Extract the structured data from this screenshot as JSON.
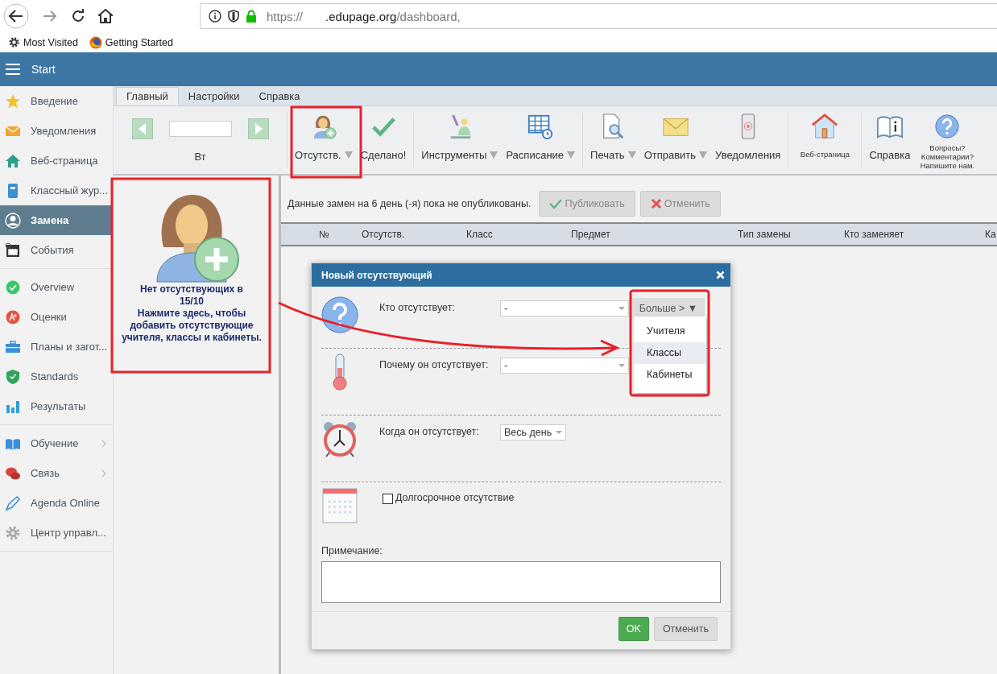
{
  "browser": {
    "url_scheme": "https://",
    "url_domain": ".edupage.org",
    "url_path": "/dashboard,",
    "bookmarks": [
      {
        "label": "Most Visited",
        "kind": "gear"
      },
      {
        "label": "Getting Started",
        "kind": "globe"
      }
    ]
  },
  "app_bar": {
    "title": "Start"
  },
  "sidebar": {
    "groups": [
      {
        "items": [
          {
            "label": "Введение",
            "kind": "star",
            "selected": false,
            "submenu": false
          },
          {
            "label": "Уведомления",
            "kind": "envelope",
            "selected": false,
            "submenu": false
          },
          {
            "label": "Веб-страница",
            "kind": "house",
            "selected": false,
            "submenu": false
          },
          {
            "label": "Классный жур...",
            "kind": "notebook",
            "selected": false,
            "submenu": false
          },
          {
            "label": "Замена",
            "kind": "user",
            "selected": true,
            "submenu": false
          },
          {
            "label": "События",
            "kind": "calendar",
            "selected": false,
            "submenu": false
          }
        ]
      },
      {
        "items": [
          {
            "label": "Overview",
            "kind": "check",
            "selected": false,
            "submenu": false
          },
          {
            "label": "Оценки",
            "kind": "grade",
            "selected": false,
            "submenu": false
          },
          {
            "label": "Планы и загот...",
            "kind": "briefcase",
            "selected": false,
            "submenu": false
          },
          {
            "label": "Standards",
            "kind": "shield",
            "selected": false,
            "submenu": false
          },
          {
            "label": "Результаты",
            "kind": "chart",
            "selected": false,
            "submenu": false
          }
        ]
      },
      {
        "items": [
          {
            "label": "Обучение",
            "kind": "book",
            "selected": false,
            "submenu": true
          },
          {
            "label": "Связь",
            "kind": "chat",
            "selected": false,
            "submenu": true
          },
          {
            "label": "Agenda Online",
            "kind": "pen",
            "selected": false,
            "submenu": false
          },
          {
            "label": "Центр управл...",
            "kind": "gear",
            "selected": false,
            "submenu": false
          }
        ]
      }
    ]
  },
  "ribbon": {
    "tabs": [
      {
        "label": "Главный",
        "selected": true
      },
      {
        "label": "Настройки",
        "selected": false
      },
      {
        "label": "Справка",
        "selected": false
      }
    ],
    "day_label": "Вт",
    "groups": [
      [
        {
          "label": "Отсутств.",
          "kind": "person-plus",
          "dropdown": true
        },
        {
          "label": "Сделано!",
          "kind": "checkmark",
          "dropdown": false
        }
      ],
      [
        {
          "label": "Инструменты",
          "kind": "tools",
          "dropdown": true
        },
        {
          "label": "Расписание",
          "kind": "timetable",
          "dropdown": true
        }
      ],
      [
        {
          "label": "Печать",
          "kind": "print",
          "dropdown": true
        },
        {
          "label": "Отправить",
          "kind": "envelope",
          "dropdown": true
        },
        {
          "label": "Уведомления",
          "kind": "phone",
          "dropdown": false
        }
      ],
      [
        {
          "label": "Веб-страница",
          "kind": "house",
          "dropdown": false
        }
      ],
      [
        {
          "label": "Справка",
          "kind": "book",
          "dropdown": false
        },
        {
          "label": "Вопросы? Комментарии? Напишите нам.",
          "kind": "question",
          "dropdown": false
        }
      ]
    ]
  },
  "empty_panel": {
    "title": "Нет отсутствующих в 15/10",
    "hint": "Нажмите здесь, чтобы добавить отсутствующие учителя, классы и кабинеты."
  },
  "notice": {
    "text": "Данные замен на 6 день (-я) пока не опубликованы.",
    "buttons": [
      {
        "label": "Публиковать",
        "kind": "publish",
        "disabled": true
      },
      {
        "label": "Отменить",
        "kind": "cancel",
        "disabled": true
      }
    ]
  },
  "table": {
    "columns": [
      "№",
      "Отсутств.",
      "Класс",
      "Предмет",
      "Тип замены",
      "Кто заменяет",
      "Ка"
    ]
  },
  "dialog": {
    "title": "Новый отсутствующий",
    "who": {
      "label": "Кто отсутствует:",
      "value": "-",
      "more_button": "Больше > ▼",
      "menu": [
        {
          "label": "Учителя",
          "selected": false
        },
        {
          "label": "Классы",
          "selected": true
        },
        {
          "label": "Кабинеты",
          "selected": false
        }
      ]
    },
    "why": {
      "label": "Почему он отсутствует:",
      "value": "-"
    },
    "when": {
      "label": "Когда он отсутствует:",
      "value": "Весь день"
    },
    "long_term": {
      "label": "Долгосрочное отсутствие",
      "checked": false
    },
    "note": {
      "label": "Примечание:"
    },
    "buttons": [
      {
        "label": "OK",
        "kind": "primary"
      },
      {
        "label": "Отменить",
        "kind": "secondary"
      }
    ]
  }
}
